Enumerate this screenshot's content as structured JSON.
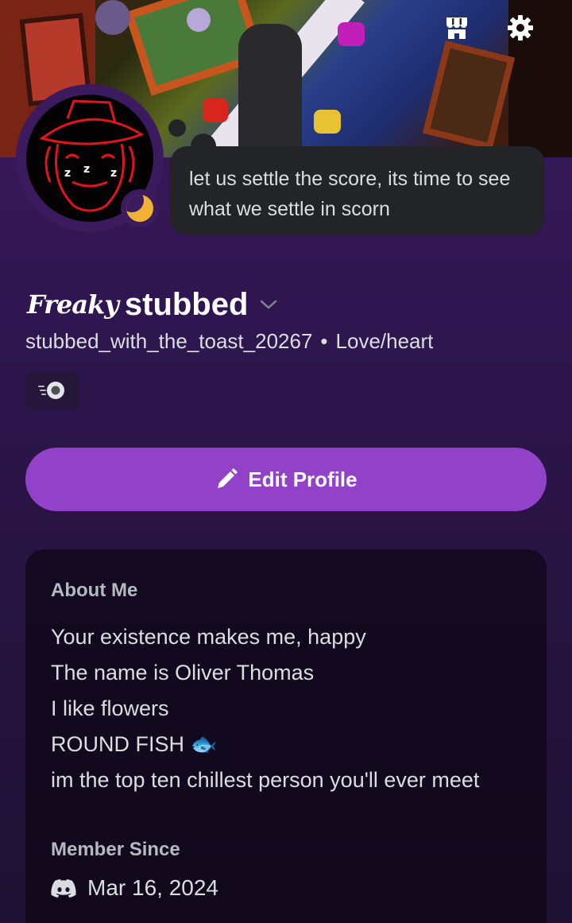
{
  "header": {
    "icons": [
      "shop-icon",
      "gear-icon"
    ]
  },
  "profile": {
    "status_text": "let us settle the score, its time to see what we settle in scorn",
    "guild_tag": "Freaky",
    "display_name": "stubbed",
    "username": "stubbed_with_the_toast_20267",
    "separator": "•",
    "pronouns": "Love/heart",
    "status": "idle",
    "badge_icon": "nitro-badge-icon"
  },
  "actions": {
    "edit_label": "Edit Profile"
  },
  "about": {
    "title": "About Me",
    "lines": [
      "Your existence makes me, happy",
      "The name is Oliver Thomas",
      "I like flowers",
      "ROUND FISH 🐟",
      "im the top ten chillest person you'll ever meet"
    ]
  },
  "member_since": {
    "title": "Member Since",
    "date": "Mar 16, 2024"
  },
  "colors": {
    "accent": "#9241c9",
    "idle": "#f0b232",
    "background": "#3b1a5e"
  }
}
